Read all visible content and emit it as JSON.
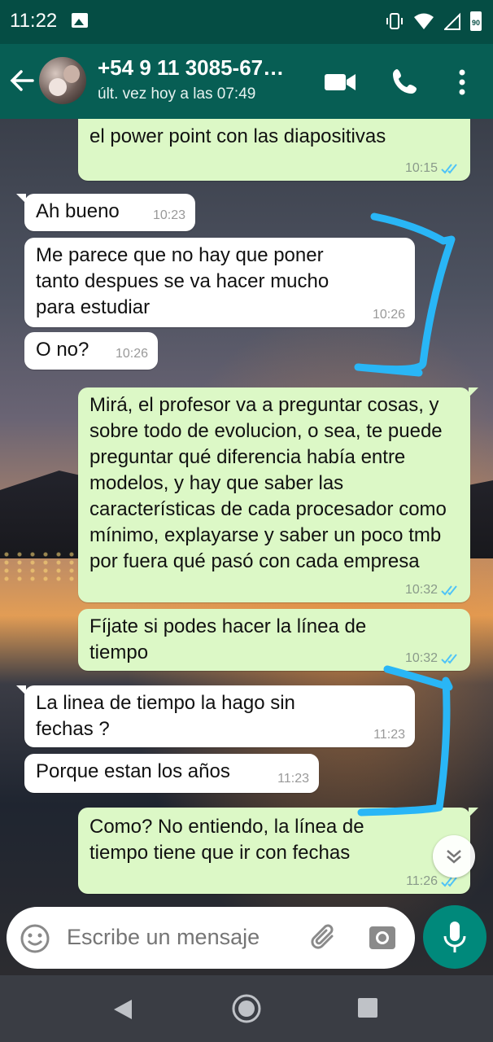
{
  "status_bar": {
    "time": "11:22",
    "battery": "90"
  },
  "header": {
    "contact_name": "+54 9 11 3085-67…",
    "last_seen": "últ. vez hoy a las 07:49"
  },
  "messages": [
    {
      "direction": "out",
      "text": "el power point con las diapositivas",
      "time": "10:15",
      "read": true
    },
    {
      "direction": "in",
      "text": "Ah bueno",
      "time": "10:23"
    },
    {
      "direction": "in",
      "text": "Me parece que no hay que poner tanto despues se va hacer mucho para estudiar",
      "time": "10:26"
    },
    {
      "direction": "in",
      "text": "O no?",
      "time": "10:26"
    },
    {
      "direction": "out",
      "text": "Mirá, el profesor va a preguntar cosas, y sobre todo de evolucion, o sea, te puede preguntar qué diferencia había entre modelos, y hay que saber las características de cada procesador como mínimo, explayarse y saber un poco tmb por fuera qué pasó con cada empresa",
      "time": "10:32",
      "read": true
    },
    {
      "direction": "out",
      "text": "Fíjate si podes hacer la línea de tiempo",
      "time": "10:32",
      "read": true
    },
    {
      "direction": "in",
      "text": "La linea de tiempo la hago sin fechas ?",
      "time": "11:23"
    },
    {
      "direction": "in",
      "text": "Porque estan los años",
      "time": "11:23"
    },
    {
      "direction": "out",
      "text": "Como? No entiendo, la línea de tiempo tiene que ir con fechas",
      "time": "11:26",
      "read": true
    }
  ],
  "input": {
    "placeholder": "Escribe un mensaje"
  },
  "colors": {
    "header": "#075e54",
    "status_bar": "#054d44",
    "outgoing_bubble": "#dcf8c6",
    "incoming_bubble": "#ffffff",
    "tick_read": "#4fc3f7",
    "mic_button": "#00897b",
    "annotation": "#29b6f6"
  }
}
